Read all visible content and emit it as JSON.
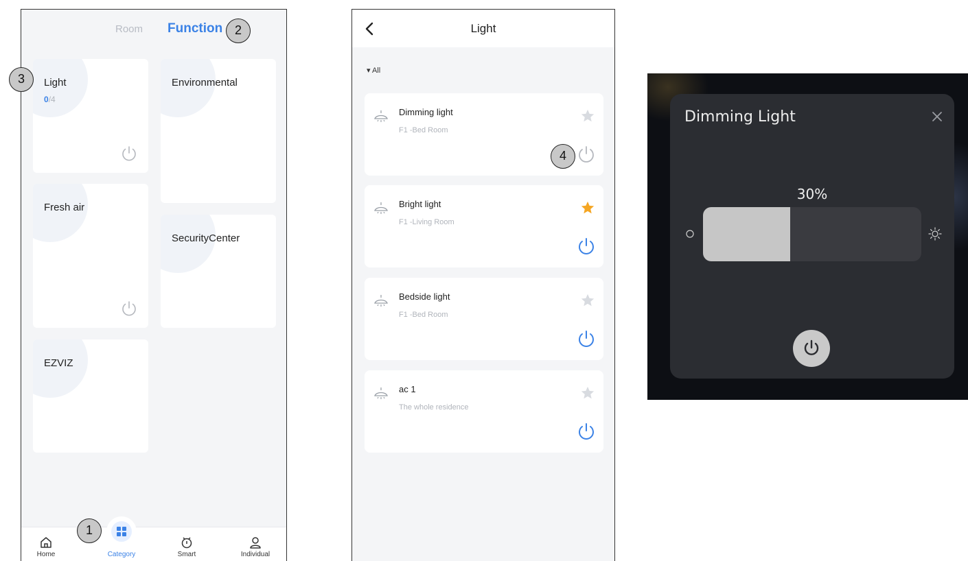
{
  "screen1": {
    "tabs": {
      "room": "Room",
      "function": "Function"
    },
    "cards": [
      {
        "title": "Light",
        "count_on": "0",
        "count_total": "/4"
      },
      {
        "title": "Environmental"
      },
      {
        "title": "Fresh air"
      },
      {
        "title": "SecurityCenter"
      },
      {
        "title": "EZVIZ"
      }
    ],
    "nav": [
      {
        "label": "Home",
        "icon": "home-icon"
      },
      {
        "label": "Category",
        "icon": "category-icon",
        "active": true
      },
      {
        "label": "Smart",
        "icon": "smart-icon"
      },
      {
        "label": "Individual",
        "icon": "user-icon"
      }
    ]
  },
  "screen2": {
    "title": "Light",
    "filter": "▾ All",
    "devices": [
      {
        "name": "Dimming light",
        "room": "F1 -Bed Room",
        "favorite": false,
        "power": "off"
      },
      {
        "name": "Bright light",
        "room": "F1 -Living Room",
        "favorite": true,
        "power": "on"
      },
      {
        "name": "Bedside light",
        "room": "F1 -Bed Room",
        "favorite": false,
        "power": "on"
      },
      {
        "name": "ac 1",
        "room": "The whole residence",
        "favorite": false,
        "power": "on"
      }
    ]
  },
  "dimmer": {
    "title": "Dimming Light",
    "percent_label": "30%",
    "brightness": 0.4
  },
  "callouts": [
    "1",
    "2",
    "3",
    "4"
  ],
  "colors": {
    "accent": "#3b82e6",
    "star_active": "#f5a623",
    "dialog_bg": "#2b2d32"
  }
}
